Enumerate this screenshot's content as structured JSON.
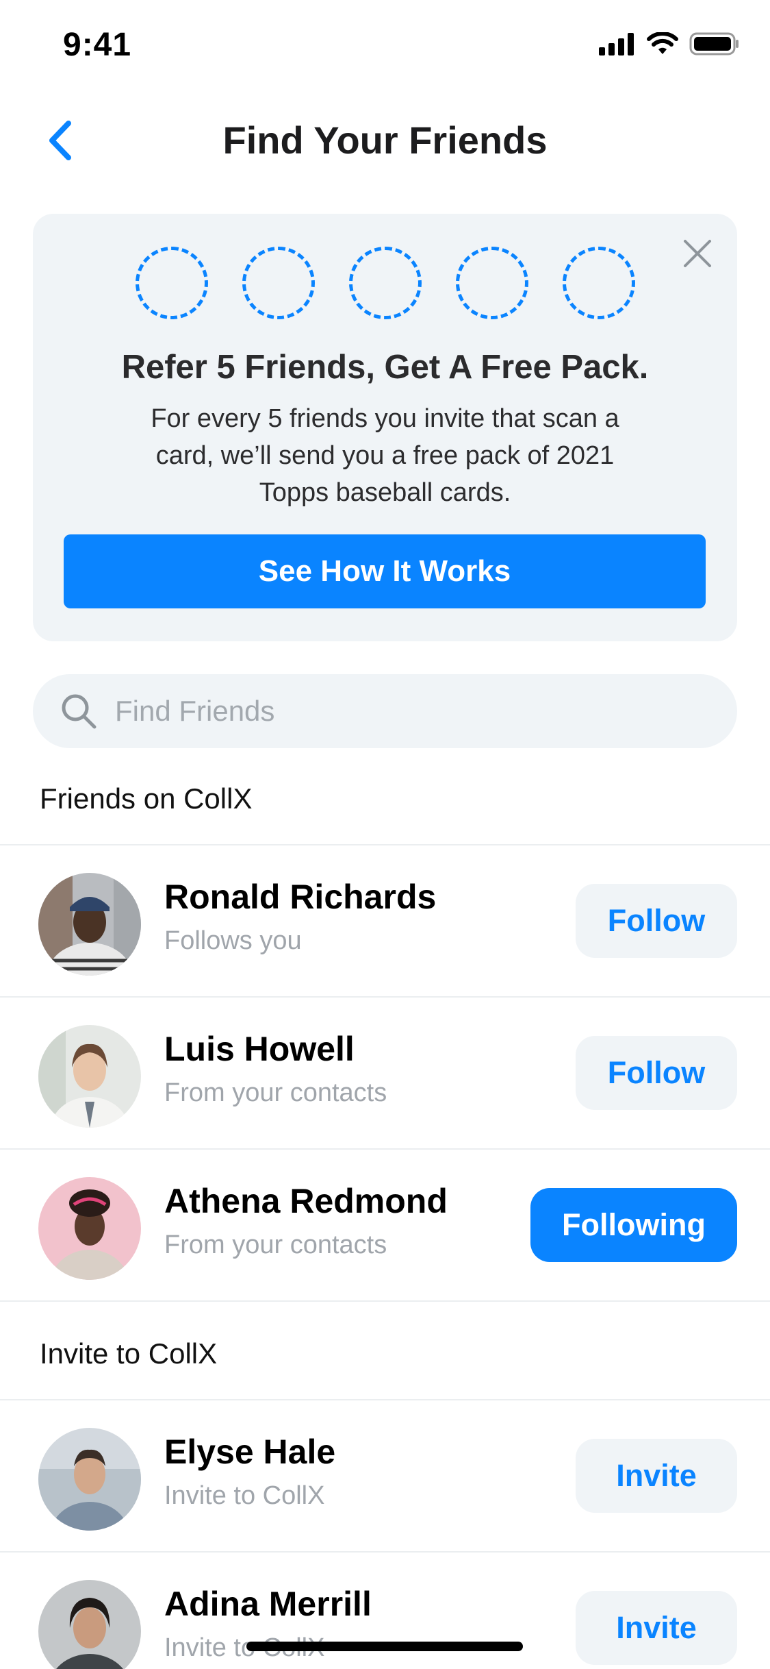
{
  "status_bar": {
    "time": "9:41"
  },
  "nav": {
    "title": "Find Your Friends"
  },
  "promo": {
    "title": "Refer 5 Friends, Get A Free Pack.",
    "body": "For every 5 friends you invite that scan a card, we’ll send you a free pack of 2021 Topps baseball cards.",
    "cta_label": "See How It Works",
    "slots_total": 5,
    "slots_filled": 0
  },
  "search": {
    "placeholder": "Find Friends"
  },
  "friends_section": {
    "title": "Friends on CollX",
    "items": [
      {
        "name": "Ronald Richards",
        "subtitle": "Follows you",
        "action": "Follow"
      },
      {
        "name": "Luis Howell",
        "subtitle": "From your contacts",
        "action": "Follow"
      },
      {
        "name": "Athena Redmond",
        "subtitle": "From your contacts",
        "action": "Following"
      }
    ]
  },
  "invite_section": {
    "title": "Invite to CollX",
    "items": [
      {
        "name": "Elyse Hale",
        "subtitle": "Invite to CollX",
        "action": "Invite"
      },
      {
        "name": "Adina Merrill",
        "subtitle": "Invite to CollX",
        "action": "Invite"
      }
    ]
  },
  "colors": {
    "accent": "#0a84ff",
    "card_bg": "#f0f4f7",
    "muted_text": "#a0a5ab"
  }
}
